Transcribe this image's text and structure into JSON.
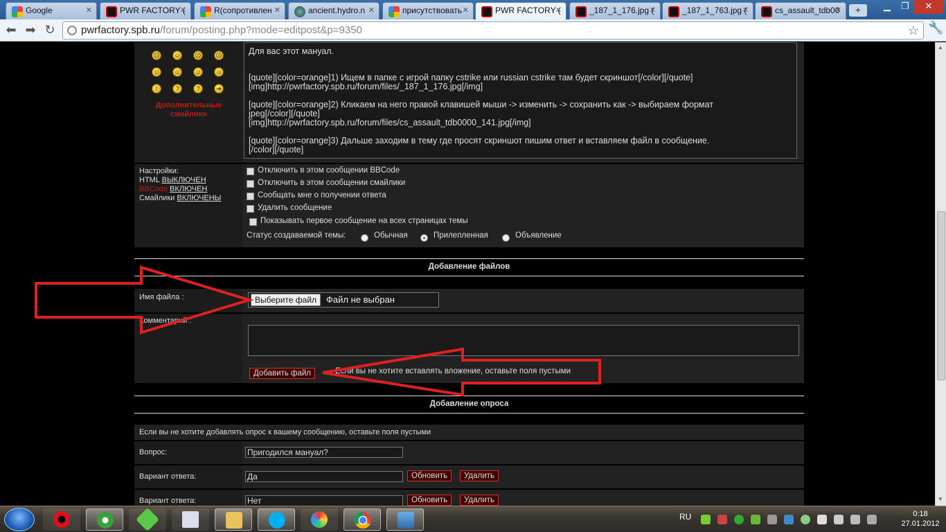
{
  "browser": {
    "tabs": [
      {
        "title": "Google",
        "icon": "google-icon"
      },
      {
        "title": "PWR FACTORY (",
        "icon": "pwr-icon"
      },
      {
        "title": "R(сопротивлен",
        "icon": "google-icon"
      },
      {
        "title": "ancient.hydro.n",
        "icon": "globe-icon"
      },
      {
        "title": "присутствовать",
        "icon": "google-icon"
      },
      {
        "title": "PWR FACTORY (",
        "icon": "pwr-icon",
        "active": true
      },
      {
        "title": "_187_1_176.jpg (",
        "icon": "pwr-icon"
      },
      {
        "title": "_187_1_763.jpg (",
        "icon": "pwr-icon"
      },
      {
        "title": "cs_assault_tdb00",
        "icon": "pwr-icon"
      }
    ],
    "new_tab": "+",
    "url_host": "pwrfactory.spb.ru",
    "url_path": "/forum/posting.php?mode=editpost&p=9350"
  },
  "smileys": {
    "more_label": "Дополнительные смайлики"
  },
  "editor": {
    "lines": [
      "Для вас этот мануал.",
      "",
      "[quote][color=orange]1) Ищем в папке с игрой папку cstrike или russian cstrike там будет скриншот[/color][/quote]",
      "[img]http://pwrfactory.spb.ru/forum/files/_187_1_176.jpg[/img]",
      "",
      "[quote][color=orange]2) Кликаем на него правой клавишей мыши -> изменить -> сохранить как -> выбираем формат",
      "jpeg[/color][/quote]",
      "[img]http://pwrfactory.spb.ru/forum/files/cs_assault_tdb0000_141.jpg[/img]",
      "",
      "[quote][color=orange]3) Дальше заходим в тему где просят скриншот пишим ответ и вставляем файл в сообщение.",
      "[/color][/quote]"
    ]
  },
  "settings": {
    "title": "Настройки:",
    "html_label": "HTML",
    "html_state": "ВЫКЛЮЧЕН",
    "bbcode_label": "BBCode",
    "bbcode_state": "ВКЛЮЧЕН",
    "smilies_label": "Смайлики",
    "smilies_state": "ВКЛЮЧЕНЫ",
    "options": [
      {
        "label": "Отключить в этом сообщении BBCode",
        "checked": false
      },
      {
        "label": "Отключить в этом сообщении смайлики",
        "checked": false
      },
      {
        "label": "Сообщать мне о получении ответа",
        "checked": false
      },
      {
        "label": "Удалить сообщение",
        "checked": false
      },
      {
        "label": "Показывать первое сообщение на всех страницах темы",
        "checked": false
      }
    ],
    "topic_status_label": "Статус создаваемой темы:",
    "topic_status_options": [
      "Обычная",
      "Прилепленная",
      "Объявление"
    ],
    "topic_status_selected": "Прилепленная"
  },
  "attachments": {
    "title": "Добавление файлов",
    "filename_label": "Имя файла :",
    "choose_button": "Выберите файл",
    "no_file": "Файл не выбран",
    "comment_label": "Комментарий :",
    "add_button": "Добавить файл",
    "hint": "Если вы не хотите вставлять вложение, оставьте поля пустыми"
  },
  "poll": {
    "title": "Добавление опроса",
    "hint": "Если вы не хотите добавлять опрос к вашему сообщению, оставьте поля пустыми",
    "question_label": "Вопрос:",
    "question_value": "Пригодился мануал?",
    "option_label": "Вариант ответа:",
    "options": [
      "Да",
      "Нет"
    ],
    "update_button": "Обновить",
    "delete_button": "Удалить"
  },
  "taskbar": {
    "lang": "RU",
    "time": "0:18",
    "date": "27.01.2012"
  },
  "colors": {
    "accent_red": "#c01818",
    "annotation_red": "#e02020",
    "panel_bg": "#222222"
  }
}
